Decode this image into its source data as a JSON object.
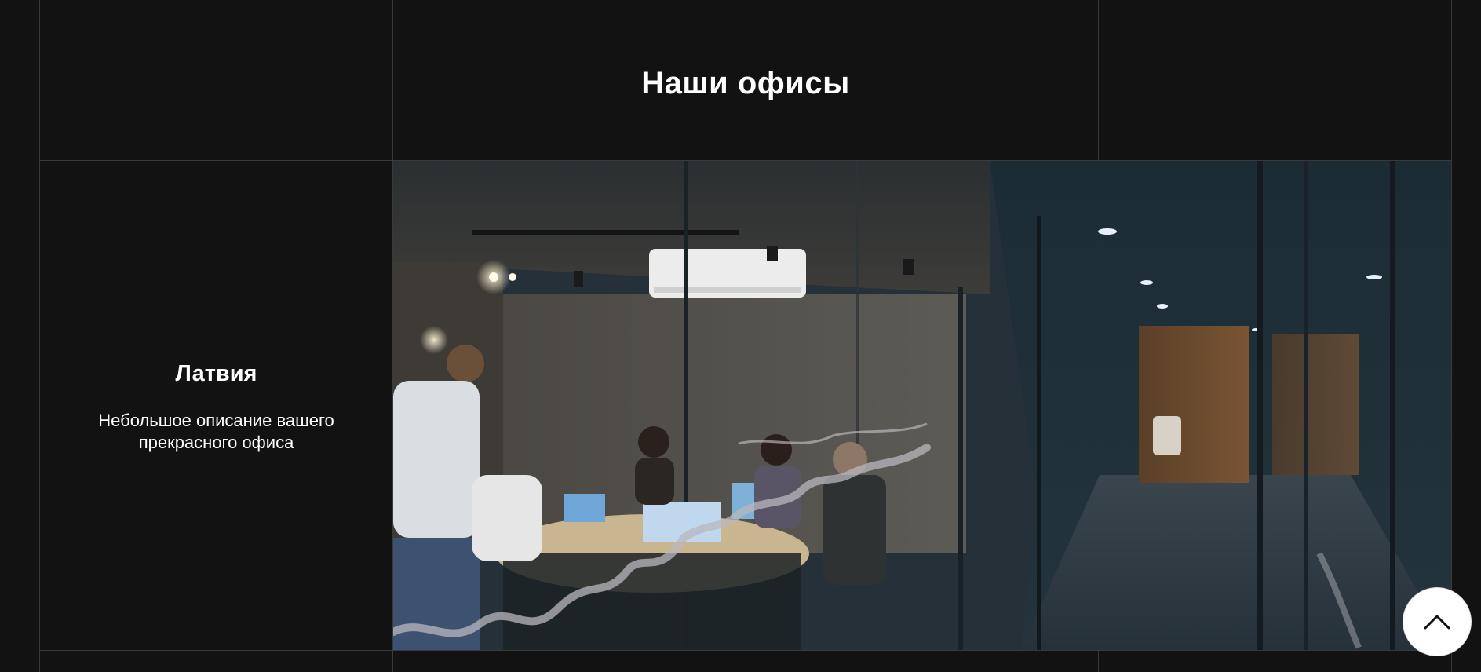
{
  "section": {
    "title": "Наши офисы"
  },
  "office": {
    "name": "Латвия",
    "description": "Небольшое описание вашего прекрасного офиса",
    "photo_alt": "Офис"
  },
  "controls": {
    "scroll_top_icon": "chevron-up-icon",
    "scroll_top_label": "Наверх"
  },
  "colors": {
    "background": "#121212",
    "grid_line": "#3a3a3a",
    "text": "#ffffff",
    "button_bg": "#ffffff",
    "button_icon": "#111111"
  }
}
